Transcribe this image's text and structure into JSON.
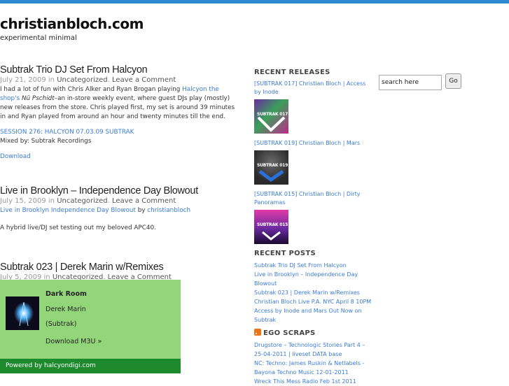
{
  "site": {
    "title": "christianbloch.com",
    "description": "experimental minimal"
  },
  "posts": [
    {
      "title": "Subtrak Trio DJ Set From Halcyon",
      "date": "July 21, 2009 in",
      "category": "Uncategorized",
      "comment": "Leave a Comment",
      "body_start": "I had a lot of fun with Chris Alker and Ryan Brogan playing",
      "body_link": "Halcyon the shop's",
      "body_italic": "Nü Pschidt",
      "body_rest": "–an in-store weekly event, where guest DJs play (mostly) new releases from the store. Chris played first, my set is around 39 minutes in and Ryan played from around an hour and twenty minutes till the end.",
      "session_link": "SESSION 276: HALCYON 07.03.09 SUBTRAK",
      "mixed_by": "Mixed by: Subtrak Recordings",
      "download": "Download"
    },
    {
      "title": "Live in Brooklyn – Independence Day Blowout",
      "date": "July 15, 2009 in",
      "category": "Uncategorized",
      "comment": "Leave a Comment",
      "track_link": "Live in Brooklyn Independence Day Blowout",
      "by": "by",
      "author": "christianbloch",
      "body": "A hybrid live/DJ set testing out my beloved APC40."
    },
    {
      "title": "Subtrak 023 | Derek Marin w/Remixes",
      "date": "July 5, 2009 in",
      "category": "Uncategorized",
      "comment": "Leave a Comment"
    }
  ],
  "sidebar": {
    "releases_heading": "RECENT RELEASES",
    "releases": [
      {
        "label": "[SUBTRAK 017] Christian Bloch | Access by Inode",
        "cover_text": "SUBTRAK 017"
      },
      {
        "label": "[SUBTRAK 019] Christian Bloch | Mars",
        "cover_text": "SUBTRAK 019"
      },
      {
        "label": "[SUBTRAK 015] Christian Bloch | Dirty Panoramas",
        "cover_text": "SUBTRAK 015"
      }
    ],
    "posts_heading": "RECENT POSTS",
    "recent_posts": [
      "Subtrak Trio DJ Set From Halcyon",
      "Live in Brooklyn – Independence Day Blowout",
      "Subtrak 023 | Derek Marin w/Remixes",
      "Christian Bloch Live P.A. NYC April 8 10PM",
      "Access by Inode and Mars Out Now on Subtrak"
    ],
    "scraps_heading": "EGO SCRAPS",
    "scraps_icon": "rss-icon",
    "scraps": [
      "Drugstore – Technologic Stories Part 4 – 25-04-2011 | liveset DATA base",
      "NC: Techno: James Ruskin & Netlabels - Bayona Techno Music 12-01-2011",
      "Wreck This Mess Radio Feb 1st 2011"
    ]
  },
  "search": {
    "placeholder": "search here",
    "button": "Go"
  },
  "player": {
    "title": "Dark Room",
    "artist": "Derek Marin",
    "label": "(Subtrak)",
    "download": "Download M3U »",
    "footer": "Powered by halcyondigi.com"
  },
  "colors": {
    "accent": "#2b8ad1",
    "link": "#3a7bd5",
    "player_bg": "#93d67a",
    "player_footer": "#1e8a2e"
  }
}
